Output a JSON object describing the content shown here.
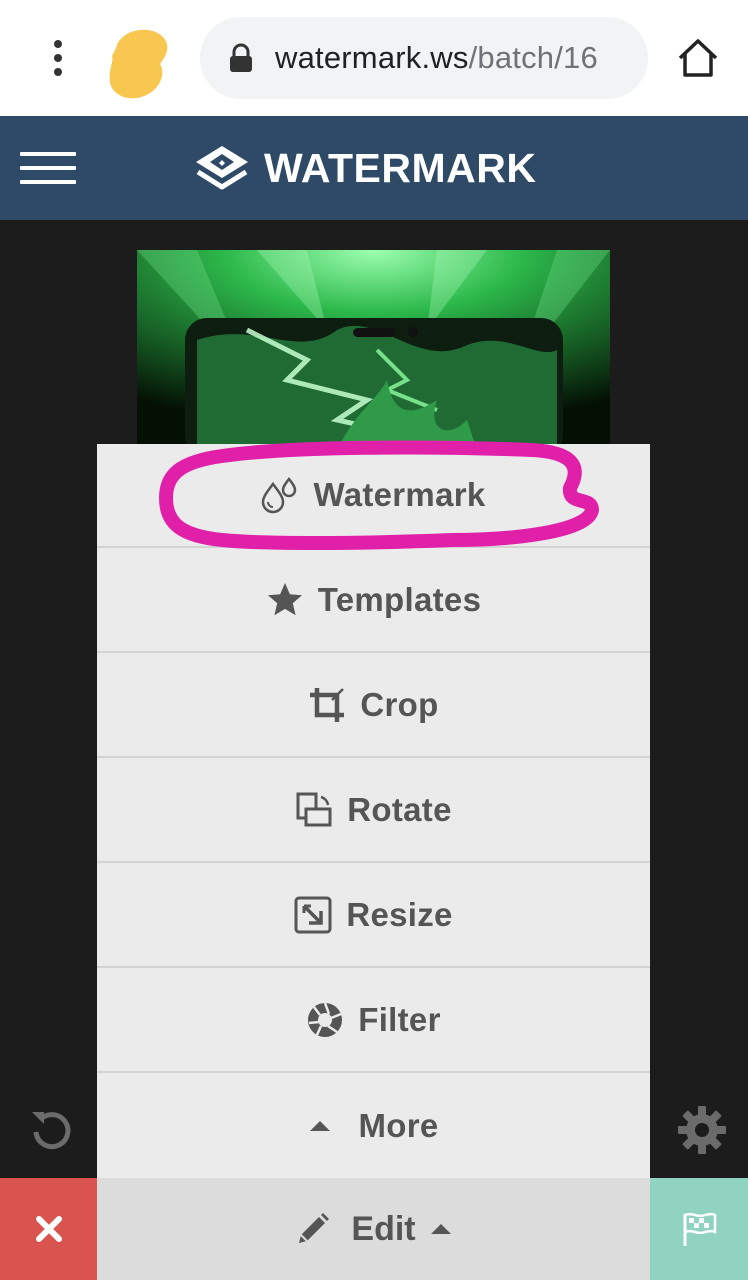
{
  "browser": {
    "url_host": "watermark.ws",
    "url_path": "/batch/16",
    "menu_icon": "kebab-menu-icon",
    "secure_icon": "lock-icon",
    "home_icon": "home-icon"
  },
  "header": {
    "brand": "WATERMARK",
    "menu_icon": "hamburger-icon",
    "background": "#2e4a66"
  },
  "menu": {
    "items": [
      {
        "label": "Watermark",
        "icon": "droplets-icon"
      },
      {
        "label": "Templates",
        "icon": "star-icon"
      },
      {
        "label": "Crop",
        "icon": "crop-icon"
      },
      {
        "label": "Rotate",
        "icon": "rotate-icon"
      },
      {
        "label": "Resize",
        "icon": "resize-icon"
      },
      {
        "label": "Filter",
        "icon": "aperture-icon"
      },
      {
        "label": "More",
        "icon": "caret-up-icon"
      }
    ],
    "highlight_color": "#e020a8"
  },
  "toolbar": {
    "undo_icon": "undo-icon",
    "settings_icon": "gear-icon"
  },
  "bottom_bar": {
    "edit_label": "Edit",
    "close_color": "#d9534f",
    "finish_color": "#8fd3c0"
  }
}
